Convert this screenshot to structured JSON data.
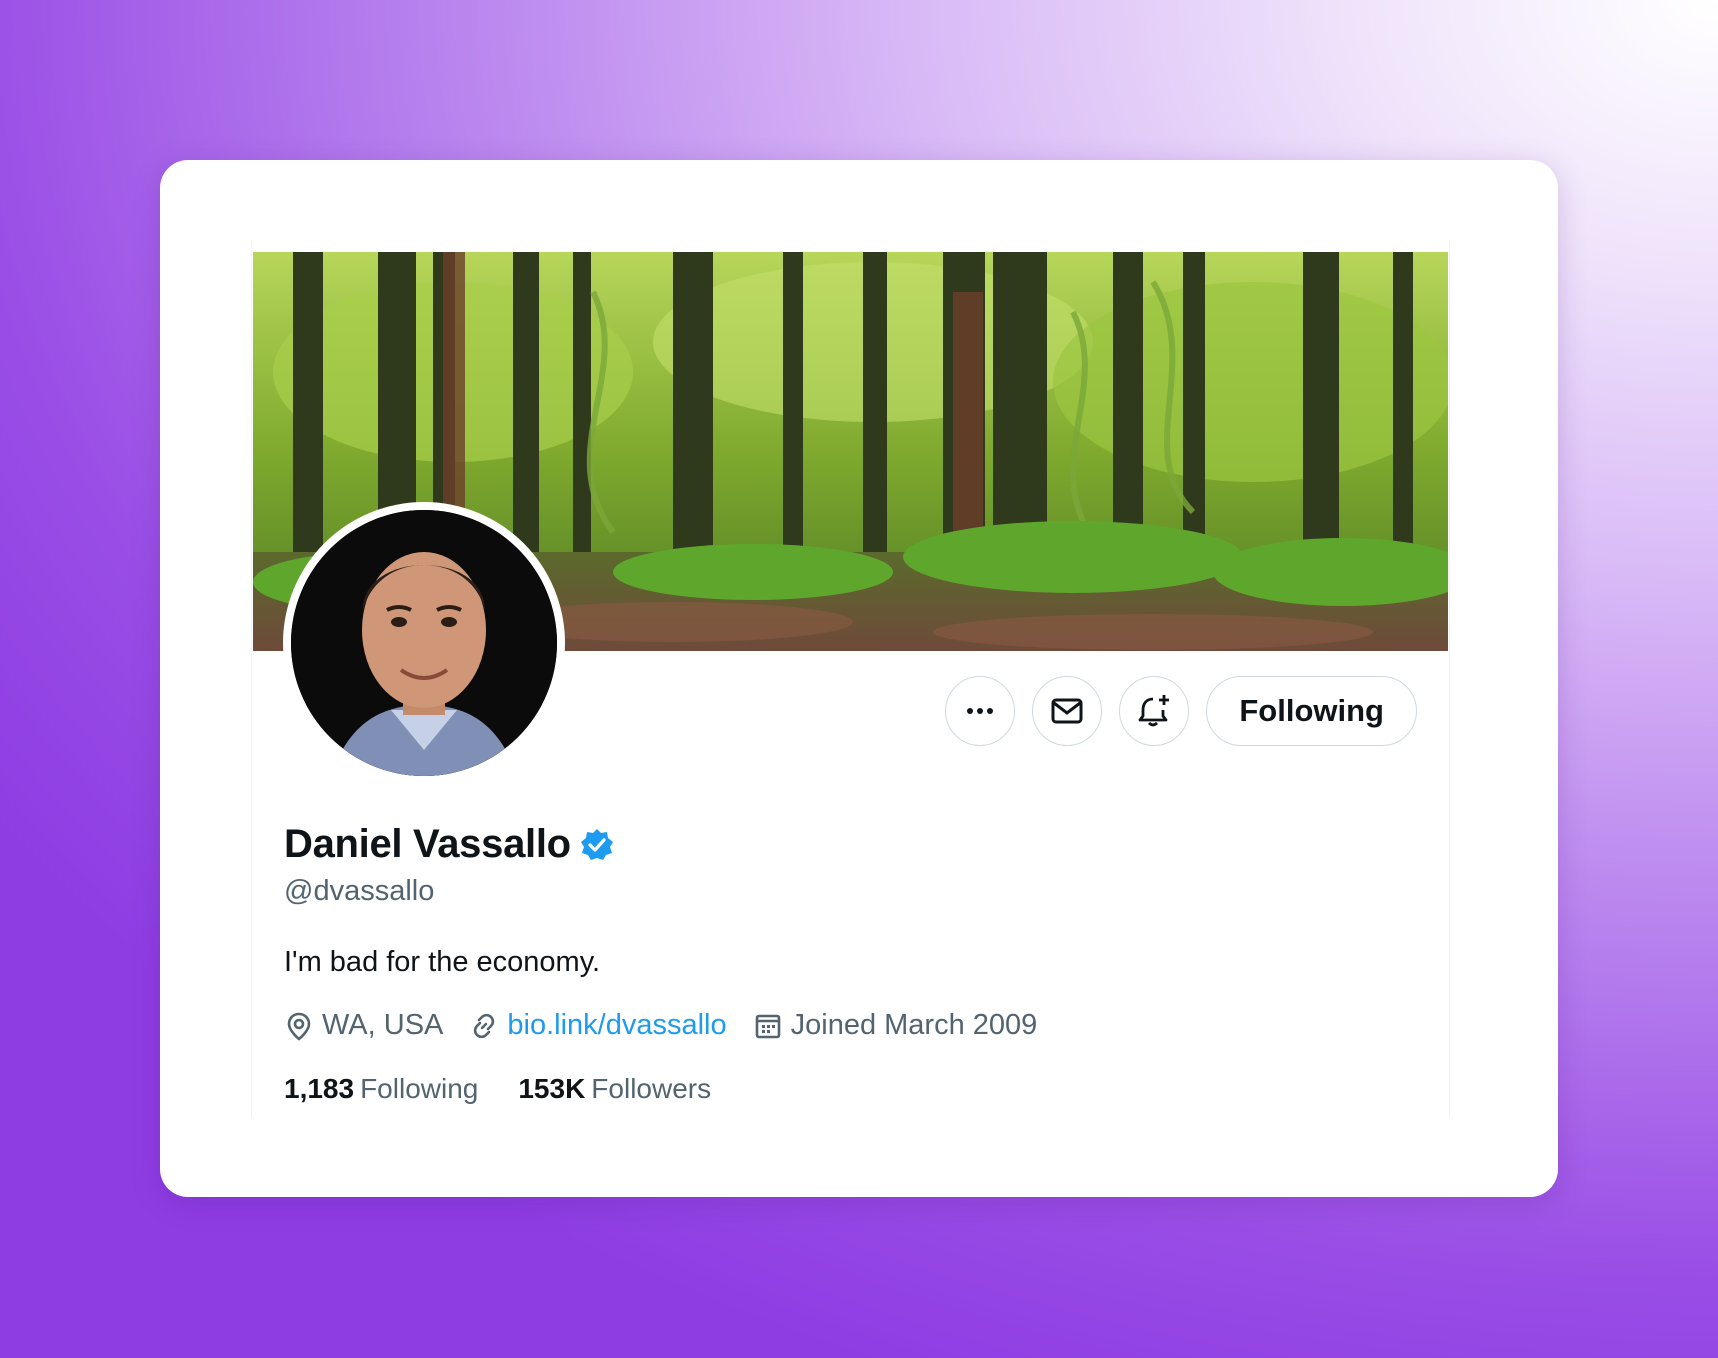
{
  "profile": {
    "display_name": "Daniel Vassallo",
    "verified_badge": "verified-badge-icon",
    "handle": "@dvassallo",
    "bio": "I'm bad for the economy.",
    "location": "WA, USA",
    "website": "bio.link/dvassallo",
    "joined": "Joined March 2009",
    "stats": {
      "following_count": "1,183",
      "following_label": "Following",
      "followers_count": "153K",
      "followers_label": "Followers"
    }
  },
  "actions": {
    "more_icon": "more-icon",
    "message_icon": "mail-icon",
    "notify_icon": "bell-plus-icon",
    "follow_label": "Following"
  },
  "colors": {
    "accent": "#1d9bf0",
    "text_primary": "#0f1419",
    "text_secondary": "#536471",
    "border": "#cfd9de"
  }
}
